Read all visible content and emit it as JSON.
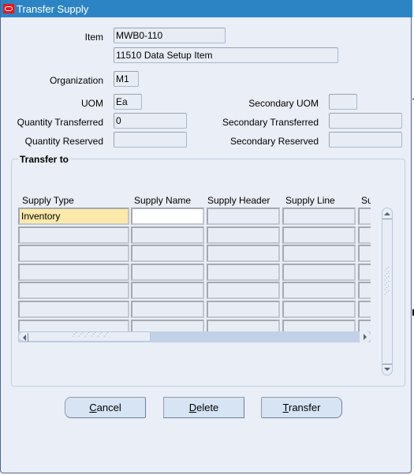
{
  "window": {
    "title": "Transfer Supply",
    "icon": "oracle-logo-icon"
  },
  "form": {
    "item_label": "Item",
    "item_value": "MWB0-110",
    "item_description": "11510 Data Setup Item",
    "organization_label": "Organization",
    "organization_value": "M1",
    "uom_label": "UOM",
    "uom_value": "Ea",
    "secondary_uom_label": "Secondary UOM",
    "secondary_uom_value": "",
    "quantity_transferred_label": "Quantity Transferred",
    "quantity_transferred_value": "0",
    "secondary_transferred_label": "Secondary Transferred",
    "secondary_transferred_value": "",
    "quantity_reserved_label": "Quantity Reserved",
    "quantity_reserved_value": "",
    "secondary_reserved_label": "Secondary Reserved",
    "secondary_reserved_value": ""
  },
  "transfer_to": {
    "title": "Transfer to",
    "columns": [
      "Supply Type",
      "Supply Name",
      "Supply Header",
      "Supply Line",
      "Su"
    ],
    "rows": [
      [
        "Inventory",
        "",
        "",
        "",
        ""
      ],
      [
        "",
        "",
        "",
        "",
        ""
      ],
      [
        "",
        "",
        "",
        "",
        ""
      ],
      [
        "",
        "",
        "",
        "",
        ""
      ],
      [
        "",
        "",
        "",
        "",
        ""
      ],
      [
        "",
        "",
        "",
        "",
        ""
      ],
      [
        "",
        "",
        "",
        "",
        ""
      ]
    ]
  },
  "buttons": {
    "cancel": {
      "mnemonic": "C",
      "rest": "ancel"
    },
    "delete": {
      "mnemonic": "D",
      "rest": "elete"
    },
    "transfer": {
      "mnemonic": "T",
      "rest": "ransfer"
    }
  }
}
